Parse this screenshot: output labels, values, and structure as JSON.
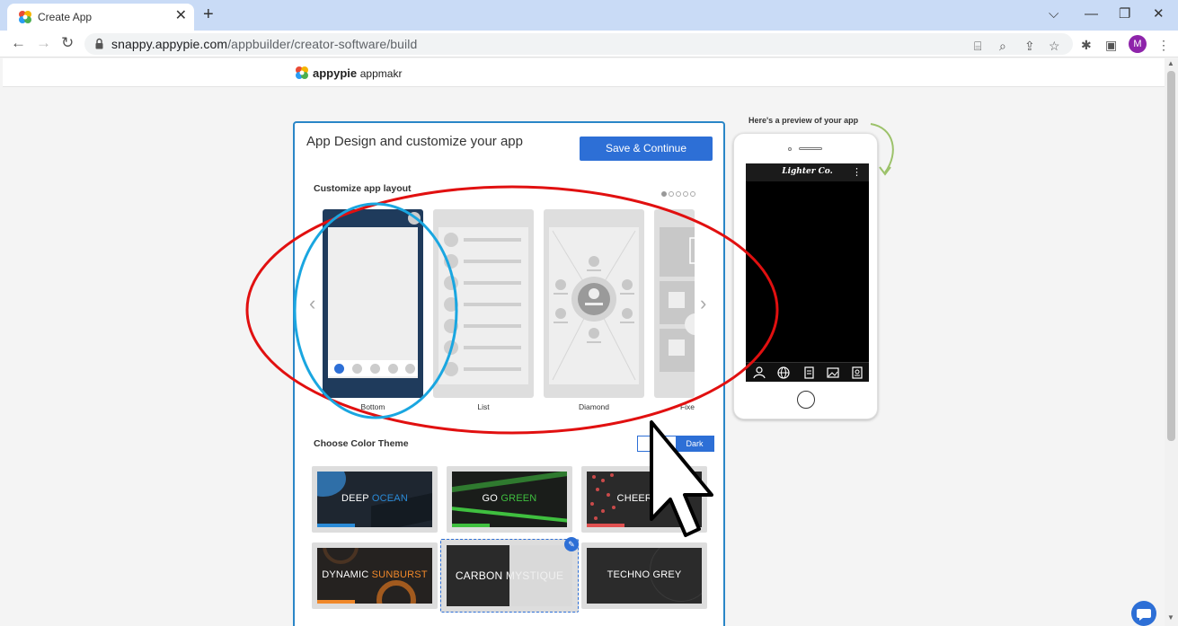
{
  "browser": {
    "tab_title": "Create App",
    "url_host": "snappy.appypie.com",
    "url_path": "/appbuilder/creator-software/build",
    "profile_initial": "M",
    "accent": "#c9dbf6"
  },
  "header": {
    "brand_name": "appypie",
    "brand_sub": "appmakr"
  },
  "panel": {
    "title": "App Design and customize your app",
    "save_label": "Save & Continue",
    "layout_section_label": "Customize app layout",
    "layouts": [
      {
        "label": "Bottom",
        "selected": true
      },
      {
        "label": "List",
        "selected": false
      },
      {
        "label": "Diamond",
        "selected": false
      },
      {
        "label": "Fixe",
        "selected": false
      }
    ],
    "color_section_label": "Choose Color Theme",
    "toggle_dark_label": "Dark",
    "themes": [
      {
        "word1": "DEEP",
        "word2": "OCEAN",
        "accent": "#2a8ad6"
      },
      {
        "word1": "GO",
        "word2": "GREEN",
        "accent": "#3fbf3f"
      },
      {
        "word1": "CHEERFUL",
        "word2": "",
        "accent": "#e05050"
      },
      {
        "word1": "DYNAMIC",
        "word2": "SUNBURST",
        "accent": "#f0882a"
      },
      {
        "word1": "CARBON",
        "word2": "MYSTIQUE",
        "accent": "#9a9a9a"
      },
      {
        "word1": "TECHNO GREY",
        "word2": "",
        "accent": "#888888"
      }
    ]
  },
  "preview": {
    "caption": "Here's a preview of your app",
    "app_title": "Lighter Co."
  },
  "colors": {
    "primary": "#2d6fd6",
    "annotation_red": "#e11010",
    "annotation_blue": "#1aa6e0"
  }
}
